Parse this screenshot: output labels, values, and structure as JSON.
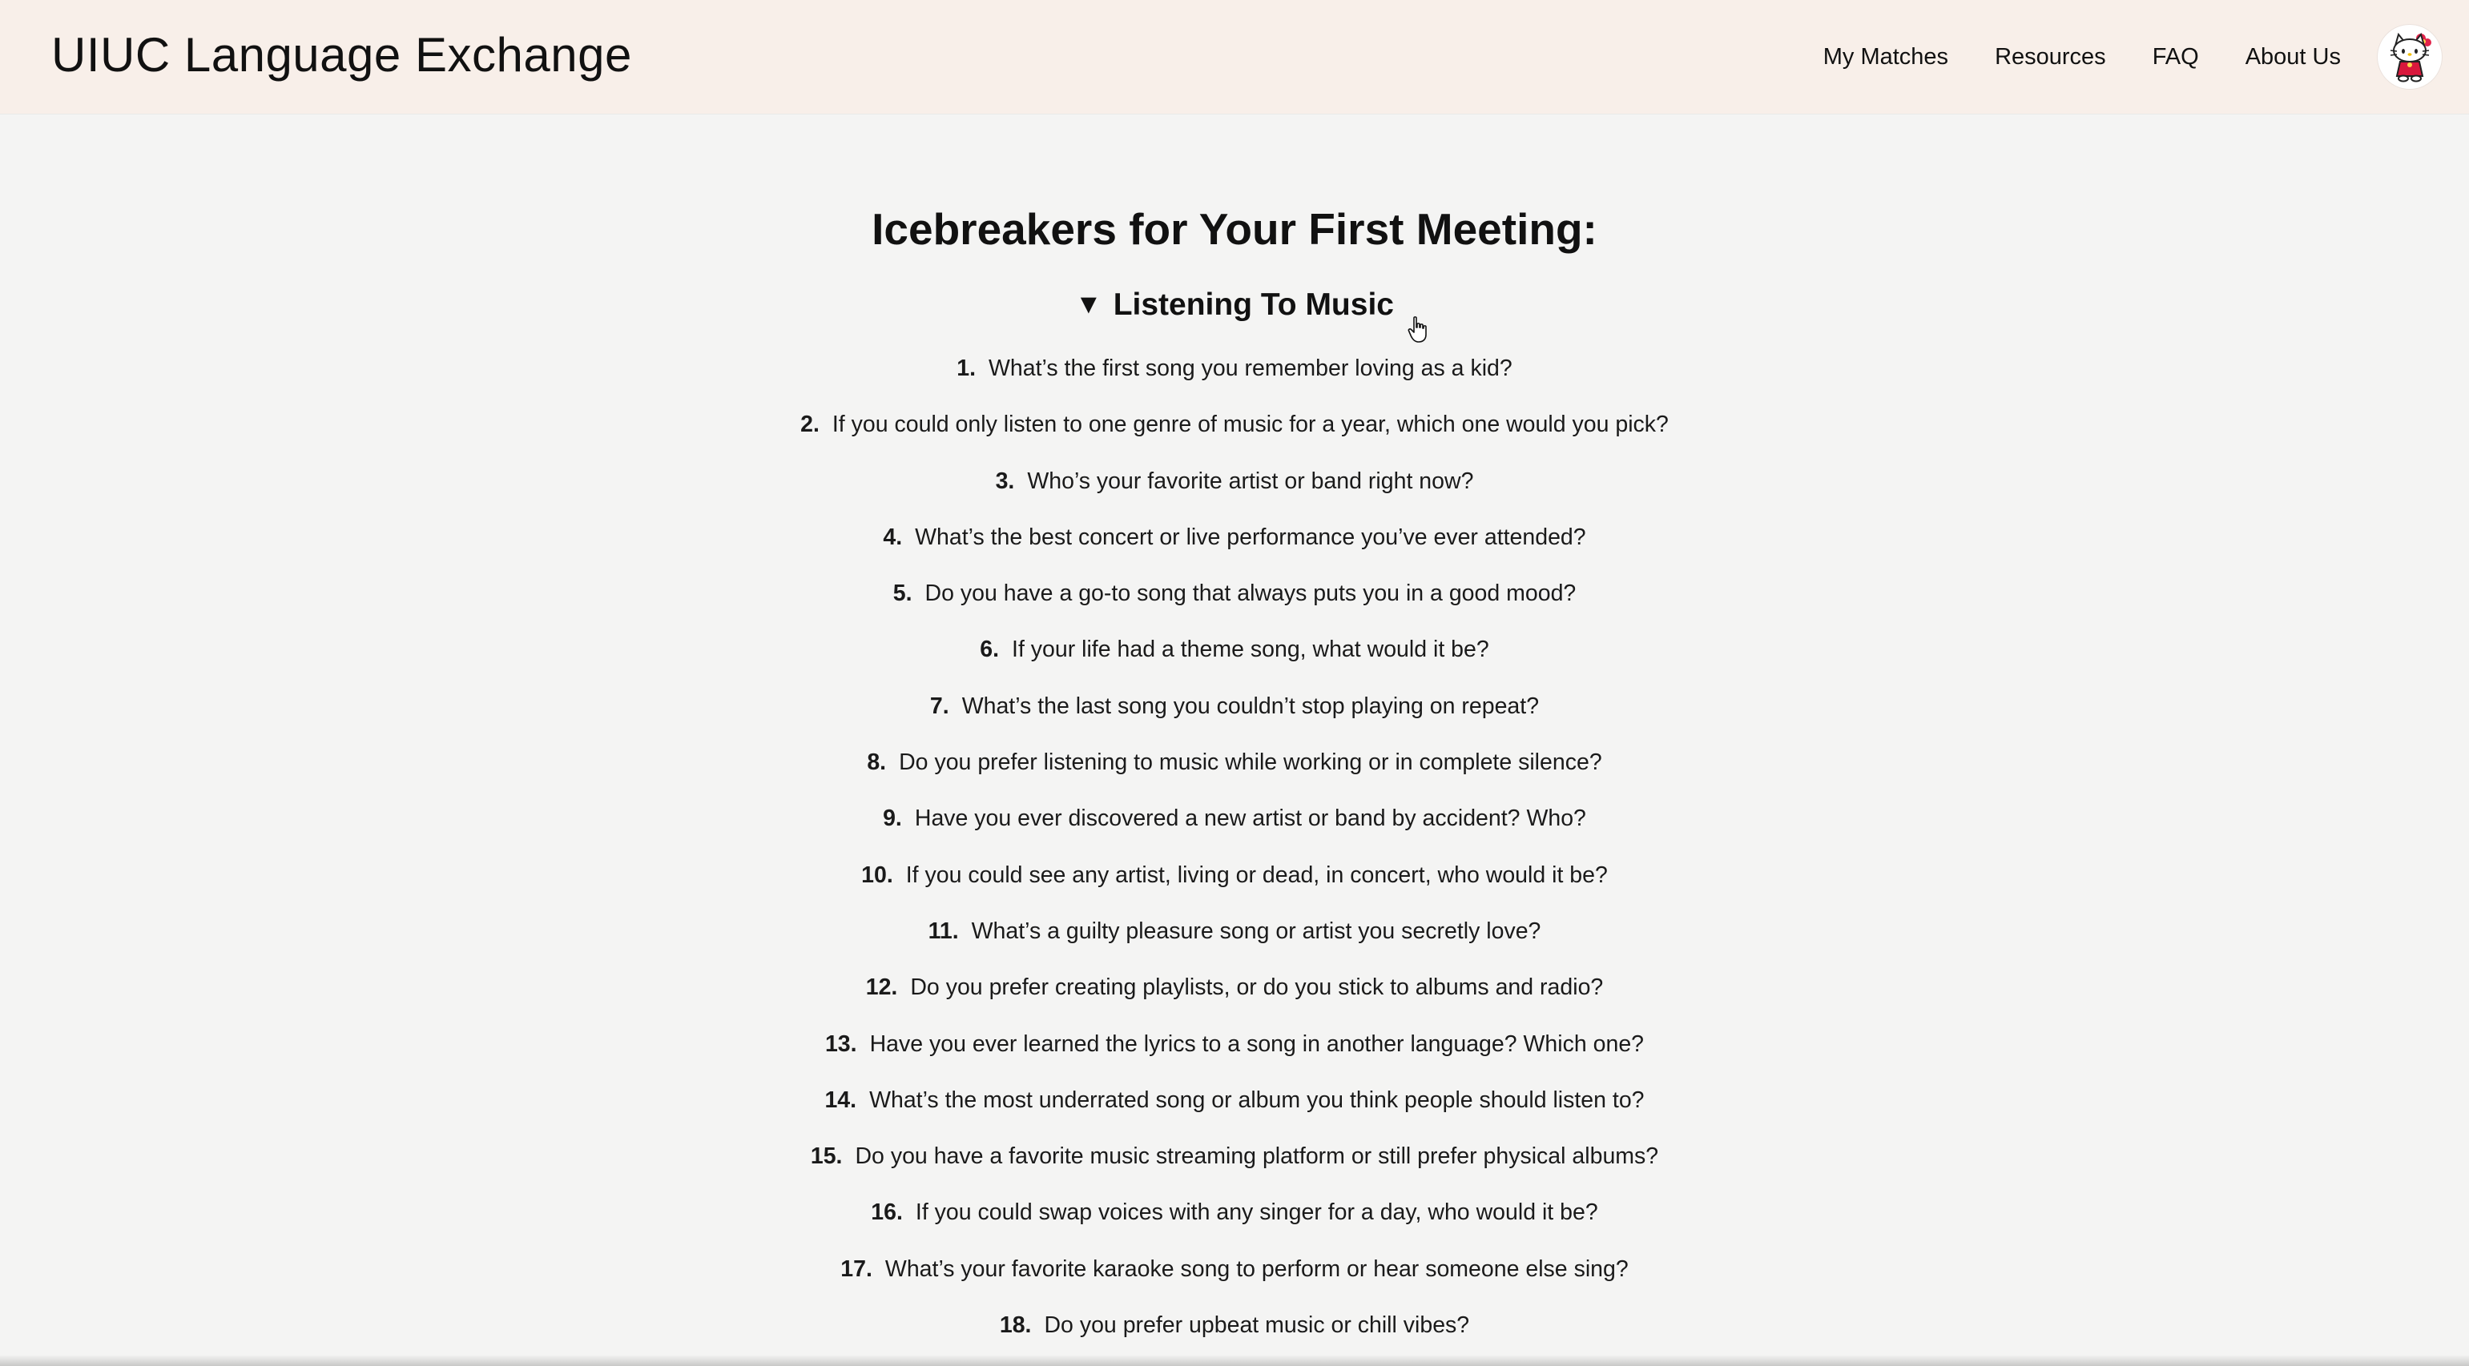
{
  "header": {
    "brand": "UIUC Language Exchange",
    "nav": [
      {
        "label": "My Matches"
      },
      {
        "label": "Resources"
      },
      {
        "label": "FAQ"
      },
      {
        "label": "About Us"
      }
    ],
    "avatar_icon": "hello-kitty-avatar-icon",
    "background": "#f8efe9"
  },
  "main": {
    "title": "Icebreakers for Your First Meeting:",
    "section": {
      "toggle_symbol": "▼",
      "title": "Listening To Music",
      "questions": [
        {
          "num": "1.",
          "text": "What’s the first song you remember loving as a kid?"
        },
        {
          "num": "2.",
          "text": "If you could only listen to one genre of music for a year, which one would you pick?"
        },
        {
          "num": "3.",
          "text": "Who’s your favorite artist or band right now?"
        },
        {
          "num": "4.",
          "text": "What’s the best concert or live performance you’ve ever attended?"
        },
        {
          "num": "5.",
          "text": "Do you have a go-to song that always puts you in a good mood?"
        },
        {
          "num": "6.",
          "text": "If your life had a theme song, what would it be?"
        },
        {
          "num": "7.",
          "text": "What’s the last song you couldn’t stop playing on repeat?"
        },
        {
          "num": "8.",
          "text": "Do you prefer listening to music while working or in complete silence?"
        },
        {
          "num": "9.",
          "text": "Have you ever discovered a new artist or band by accident? Who?"
        },
        {
          "num": "10.",
          "text": "If you could see any artist, living or dead, in concert, who would it be?"
        },
        {
          "num": "11.",
          "text": "What’s a guilty pleasure song or artist you secretly love?"
        },
        {
          "num": "12.",
          "text": "Do you prefer creating playlists, or do you stick to albums and radio?"
        },
        {
          "num": "13.",
          "text": "Have you ever learned the lyrics to a song in another language? Which one?"
        },
        {
          "num": "14.",
          "text": "What’s the most underrated song or album you think people should listen to?"
        },
        {
          "num": "15.",
          "text": "Do you have a favorite music streaming platform or still prefer physical albums?"
        },
        {
          "num": "16.",
          "text": "If you could swap voices with any singer for a day, who would it be?"
        },
        {
          "num": "17.",
          "text": "What’s your favorite karaoke song to perform or hear someone else sing?"
        },
        {
          "num": "18.",
          "text": "Do you prefer upbeat music or chill vibes?"
        }
      ]
    }
  },
  "colors": {
    "page_background": "#f4f4f3",
    "text": "#111111"
  }
}
